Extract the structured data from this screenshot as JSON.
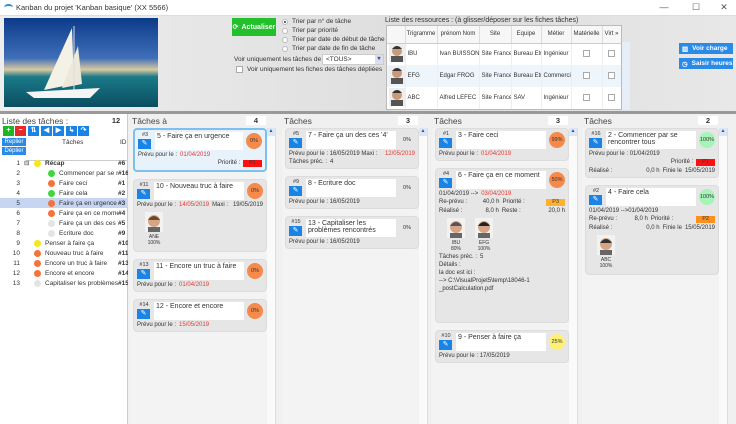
{
  "window": {
    "title": "Kanban du projet 'Kanban basique' (XX 5566)",
    "min": "—",
    "max": "☐",
    "close": "✕"
  },
  "toolbar": {
    "refresh_label": "Actualiser",
    "sort_options": [
      {
        "label": "Trier par n° de tâche",
        "selected": true
      },
      {
        "label": "Trier par priorité",
        "selected": false
      },
      {
        "label": "Trier par date de début de tâche",
        "selected": false
      },
      {
        "label": "Trier par date de fin de tâche",
        "selected": false
      }
    ],
    "filter_label": "Voir uniquement les tâches de :",
    "filter_value": "<TOUS>",
    "unfolded_only_label": "Voir uniquement les fiches des tâches dépliées"
  },
  "resources": {
    "title": "Liste des ressources : (à glisser/déposer sur les fiches tâches)",
    "columns": [
      "Trigramme",
      "prénom Nom",
      "Site",
      "Equipe",
      "Métier",
      "Matérielle",
      "Virt »"
    ],
    "rows": [
      {
        "tri": "IBU",
        "name": "Ivan BUISSON",
        "site": "Site France",
        "team": "Bureau Etudes",
        "job": "Ingénieur"
      },
      {
        "tri": "EFG",
        "name": "Edgar FROG",
        "site": "Site France",
        "team": "Bureau Etudes",
        "job": "Commercia"
      },
      {
        "tri": "ABC",
        "name": "Alfred LEFEC",
        "site": "Site France",
        "team": "SAV",
        "job": "Ingénieur"
      }
    ],
    "load_button": "Voir charge",
    "hours_button": "Saisir heures"
  },
  "tasklist": {
    "title": "Liste des tâches :",
    "count": "12",
    "collapse": "Replier",
    "expand": "Déplier",
    "col_tasks": "Tâches",
    "col_id": "ID",
    "rows": [
      {
        "n": "1",
        "title": "Récap",
        "color": "#f5e61e",
        "id": "#6",
        "lvl": 0,
        "bold": true,
        "exp": "⊟"
      },
      {
        "n": "2",
        "title": "Commencer par se rencontrer tous",
        "color": "#3fd63f",
        "id": "#16",
        "lvl": 1
      },
      {
        "n": "3",
        "title": "Faire ceci",
        "color": "#f4733a",
        "id": "#1",
        "lvl": 1
      },
      {
        "n": "4",
        "title": "Faire cela",
        "color": "#3fd63f",
        "id": "#2",
        "lvl": 1
      },
      {
        "n": "5",
        "title": "Faire ça en urgence",
        "color": "#f4733a",
        "id": "#3",
        "lvl": 1,
        "sel": true
      },
      {
        "n": "6",
        "title": "Faire ça en ce moment",
        "color": "#f4733a",
        "id": "#4",
        "lvl": 1
      },
      {
        "n": "7",
        "title": "Faire ça un des ces '4'",
        "color": "#e4e4e4",
        "id": "#5",
        "lvl": 1
      },
      {
        "n": "8",
        "title": "Ecriture doc",
        "color": "#e4e4e4",
        "id": "#9",
        "lvl": 1
      },
      {
        "n": "9",
        "title": "Penser à faire ça",
        "color": "#f5e61e",
        "id": "#10",
        "lvl": 0
      },
      {
        "n": "10",
        "title": "Nouveau truc à faire",
        "color": "#f4733a",
        "id": "#11",
        "lvl": 0
      },
      {
        "n": "11",
        "title": "Encore un truc à faire",
        "color": "#f4733a",
        "id": "#13",
        "lvl": 0
      },
      {
        "n": "12",
        "title": "Encore et encore",
        "color": "#f4733a",
        "id": "#14",
        "lvl": 0
      },
      {
        "n": "13",
        "title": "Capitaliser les problèmes rencontrés",
        "color": "#e4e4e4",
        "id": "#15",
        "lvl": 0
      }
    ]
  },
  "lanes": [
    {
      "title": "Tâches à traiter aujourd'hui :",
      "count": "4",
      "cards": [
        {
          "id": "#3",
          "title": "5 - Faire ça en urgence",
          "pct": "0%",
          "pctColor": "#f58a4b",
          "selected": true,
          "rows": [
            [
              {
                "t": "Prévu pour le :"
              },
              {
                "t": "01/04/2019",
                "c": "red"
              }
            ],
            [
              {
                "t": "",
                "c": "grow"
              },
              {
                "t": "Priorité :"
              },
              {
                "t": "P1",
                "c": "badge",
                "bg": "#ff1010"
              }
            ]
          ]
        },
        {
          "id": "#11",
          "title": "10 - Nouveau truc à faire",
          "pct": "0%",
          "pctColor": "#f58a4b",
          "rows": [
            [
              {
                "t": "Prévu pour le :"
              },
              {
                "t": "14/05/2019",
                "c": "red"
              },
              {
                "t": "Maxi :",
                "c": "grow"
              },
              {
                "t": "19/05/2019"
              }
            ]
          ],
          "avatars": [
            {
              "name": "ANE",
              "pct": "100%",
              "hair": "#6b4a2a"
            }
          ]
        },
        {
          "id": "#13",
          "title": "11 - Encore un truc à faire",
          "pct": "0%",
          "pctColor": "#f58a4b",
          "rows": [
            [
              {
                "t": "Prévu pour le :"
              },
              {
                "t": "01/04/2019",
                "c": "red"
              }
            ]
          ]
        },
        {
          "id": "#14",
          "title": "12 - Encore et encore",
          "pct": "0%",
          "pctColor": "#f58a4b",
          "rows": [
            [
              {
                "t": "Prévu pour le :"
              },
              {
                "t": "15/05/2019",
                "c": "red"
              }
            ]
          ]
        }
      ]
    },
    {
      "title": "Tâches à traiter plus tard :",
      "count": "3",
      "cards": [
        {
          "id": "#5",
          "title": "7 - Faire ça un des ces '4'",
          "pct": "0%",
          "rows": [
            [
              {
                "t": "Prévu pour le : 16/05/2019 Maxi :",
                "c": "grow"
              },
              {
                "t": "12/05/2019",
                "c": "red"
              }
            ],
            [
              {
                "t": "Tâches préc. :"
              },
              {
                "t": "4"
              }
            ]
          ]
        },
        {
          "id": "#9",
          "title": "8 - Ecriture doc",
          "pct": "0%",
          "rows": [
            [
              {
                "t": "Prévu pour le : 16/05/2019"
              }
            ]
          ]
        },
        {
          "id": "#15",
          "title": "13 - Capitaliser les problèmes rencontrés",
          "pct": "0%",
          "rows": [
            [
              {
                "t": "Prévu pour le : 16/05/2019"
              }
            ]
          ]
        }
      ]
    },
    {
      "title": "Tâches en cours :",
      "count": "3",
      "cards": [
        {
          "id": "#1",
          "title": "3 - Faire ceci",
          "pct": "99%",
          "pctColor": "#f58a4b",
          "rows": [
            [
              {
                "t": "Prévu pour le :"
              },
              {
                "t": "01/04/2019",
                "c": "red"
              }
            ]
          ]
        },
        {
          "id": "#4",
          "title": "6 - Faire ça en ce moment",
          "pct": "50%",
          "pctColor": "#f58a4b",
          "rows": [
            [
              {
                "t": "01/04/2019 -->"
              },
              {
                "t": "03/04/2019",
                "c": "red"
              }
            ],
            [
              {
                "t": "Re-prévu :",
                "c": "grow"
              },
              {
                "t": "40,0 h"
              },
              {
                "t": "Priorité :",
                "c": "grow"
              },
              {
                "t": "P3",
                "c": "badge",
                "bg": "#ffb030"
              }
            ],
            [
              {
                "t": "Réalisé :",
                "c": "grow"
              },
              {
                "t": "8,0 h"
              },
              {
                "t": "Reste :",
                "c": "grow"
              },
              {
                "t": "20,0 h"
              }
            ]
          ],
          "avatars": [
            {
              "name": "IBU",
              "pct": "80%",
              "hair": "#555"
            },
            {
              "name": "EFG",
              "pct": "100%",
              "hair": "#222"
            }
          ],
          "after": [
            [
              {
                "t": "Tâches préc. :"
              },
              {
                "t": "5"
              }
            ],
            [
              {
                "t": "Détails :"
              }
            ],
            [
              {
                "t": "la doc est ici :"
              }
            ],
            [
              {
                "t": " --> C:\\VisualProjet5\\temp\\18046-1"
              }
            ],
            [
              {
                "t": "_postCalculation.pdf"
              }
            ]
          ],
          "pad": true
        },
        {
          "id": "#10",
          "title": "9 - Penser à faire ça",
          "pct": "25%",
          "pctColor": "#fff176",
          "rows": [
            [
              {
                "t": "Prévu pour le : 17/05/2019"
              }
            ]
          ]
        }
      ]
    },
    {
      "title": "Tâches terminées :",
      "count": "2",
      "cards": [
        {
          "id": "#16",
          "title": "2 - Commencer par se rencontrer tous",
          "pct": "100%",
          "pctColor": "#a6f5b8",
          "rows": [
            [
              {
                "t": "Prévu pour le : 01/04/2019"
              }
            ],
            [
              {
                "t": "",
                "c": "grow"
              },
              {
                "t": "Priorité :"
              },
              {
                "t": "P1",
                "c": "badge",
                "bg": "#ff1010"
              }
            ],
            [
              {
                "t": "Réalisé :",
                "c": "grow"
              },
              {
                "t": "0,0 h"
              },
              {
                "t": "Finie le"
              },
              {
                "t": "15/05/2019"
              }
            ]
          ]
        },
        {
          "id": "#2",
          "title": "4 - Faire cela",
          "pct": "100%",
          "pctColor": "#a6f5b8",
          "rows": [
            [
              {
                "t": "01/04/2019 -->01/04/2019"
              }
            ],
            [
              {
                "t": "Re-prévu :",
                "c": "grow"
              },
              {
                "t": "8,0 h"
              },
              {
                "t": "Priorité :",
                "c": "grow"
              },
              {
                "t": "P2",
                "c": "badge",
                "bg": "#ff9020"
              }
            ],
            [
              {
                "t": "Réalisé :",
                "c": "grow"
              },
              {
                "t": "0,0 h"
              },
              {
                "t": "Finie le"
              },
              {
                "t": "15/05/2019"
              }
            ]
          ],
          "avatars": [
            {
              "name": "ABC",
              "pct": "100%",
              "hair": "#333"
            }
          ]
        }
      ]
    }
  ]
}
